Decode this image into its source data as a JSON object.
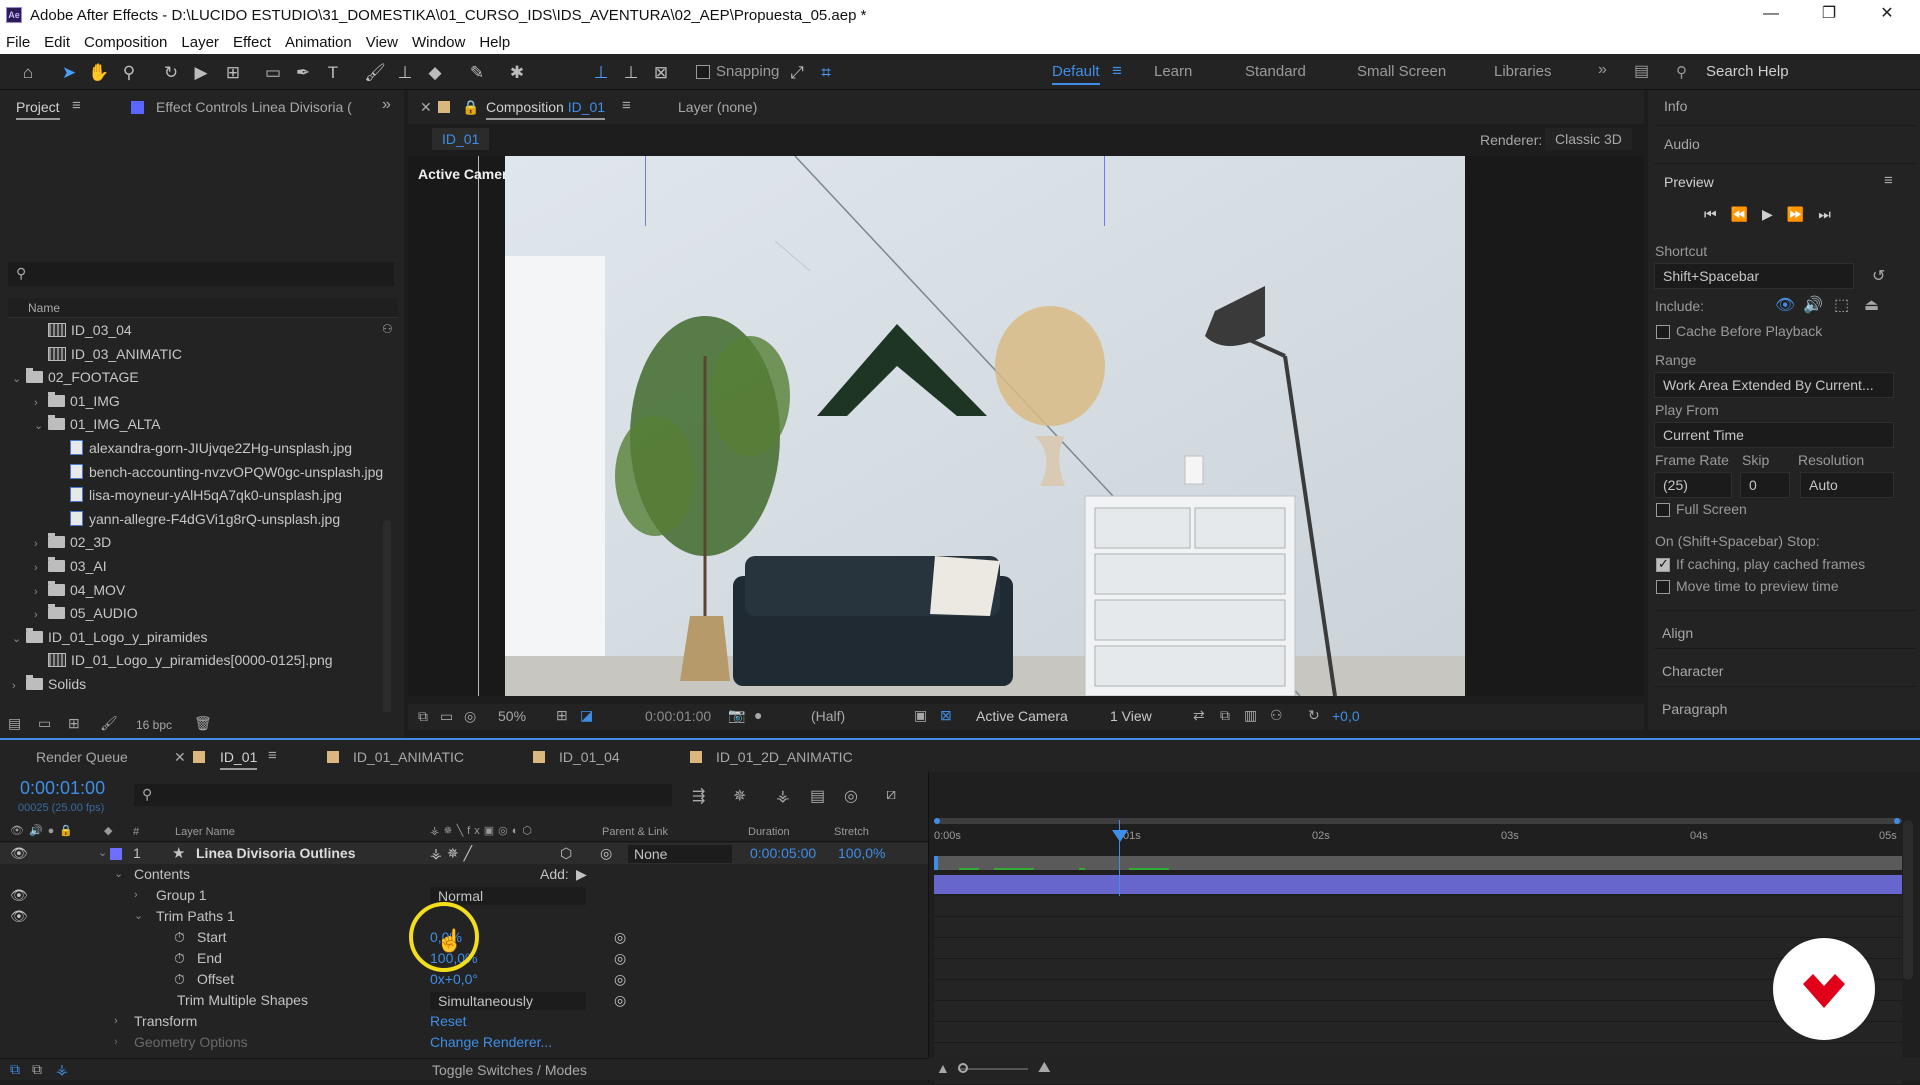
{
  "window": {
    "title": "Adobe After Effects - D:\\LUCIDO ESTUDIO\\31_DOMESTIKA\\01_CURSO_IDS\\IDS_AVENTURA\\02_AEP\\Propuesta_05.aep *",
    "app_icon": "Ae"
  },
  "menu": [
    "File",
    "Edit",
    "Composition",
    "Layer",
    "Effect",
    "Animation",
    "View",
    "Window",
    "Help"
  ],
  "toolbar": {
    "snapping": "Snapping",
    "workspaces": [
      "Default",
      "Learn",
      "Standard",
      "Small Screen",
      "Libraries"
    ],
    "search_placeholder": "Search Help"
  },
  "project_panel": {
    "tab": "Project",
    "effect_tab": "Effect Controls Linea Divisoria (",
    "col_name": "Name",
    "bpc": "16 bpc",
    "items": [
      {
        "label": "ID_03_04",
        "type": "comp",
        "indent": 1
      },
      {
        "label": "ID_03_ANIMATIC",
        "type": "comp",
        "indent": 1
      },
      {
        "label": "02_FOOTAGE",
        "type": "folder",
        "indent": 0,
        "open": true
      },
      {
        "label": "01_IMG",
        "type": "folder",
        "indent": 1,
        "open": false
      },
      {
        "label": "01_IMG_ALTA",
        "type": "folder",
        "indent": 1,
        "open": true
      },
      {
        "label": "alexandra-gorn-JIUjvqe2ZHg-unsplash.jpg",
        "type": "file",
        "indent": 2
      },
      {
        "label": "bench-accounting-nvzvOPQW0gc-unsplash.jpg",
        "type": "file",
        "indent": 2
      },
      {
        "label": "lisa-moyneur-yAlH5qA7qk0-unsplash.jpg",
        "type": "file",
        "indent": 2
      },
      {
        "label": "yann-allegre-F4dGVi1g8rQ-unsplash.jpg",
        "type": "file",
        "indent": 2
      },
      {
        "label": "02_3D",
        "type": "folder",
        "indent": 1,
        "open": false
      },
      {
        "label": "03_AI",
        "type": "folder",
        "indent": 1,
        "open": false
      },
      {
        "label": "04_MOV",
        "type": "folder",
        "indent": 1,
        "open": false
      },
      {
        "label": "05_AUDIO",
        "type": "folder",
        "indent": 1,
        "open": false
      },
      {
        "label": "ID_01_Logo_y_piramides",
        "type": "folder",
        "indent": 0,
        "open": true
      },
      {
        "label": "ID_01_Logo_y_piramides[0000-0125].png",
        "type": "comp",
        "indent": 1
      },
      {
        "label": "Solids",
        "type": "folder",
        "indent": 0,
        "open": false
      }
    ]
  },
  "comp_panel": {
    "tab_prefix": "Composition ",
    "tab_comp": "ID_01",
    "layer_tab": "Layer  (none)",
    "breadcrumb": "ID_01",
    "renderer_label": "Renderer:",
    "renderer": "Classic 3D",
    "active_camera": "Active Camera",
    "footer": {
      "zoom": "50%",
      "time": "0:00:01:00",
      "resolution": "(Half)",
      "view": "Active Camera",
      "views": "1 View",
      "exposure": "+0,0"
    }
  },
  "right_panel": {
    "info": "Info",
    "audio": "Audio",
    "preview": "Preview",
    "shortcut_label": "Shortcut",
    "shortcut": "Shift+Spacebar",
    "include_label": "Include:",
    "cache_before": "Cache Before Playback",
    "range_label": "Range",
    "range": "Work Area Extended By Current...",
    "play_from_label": "Play From",
    "play_from": "Current Time",
    "frame_rate_label": "Frame Rate",
    "skip_label": "Skip",
    "resolution_label": "Resolution",
    "frame_rate": "(25)",
    "skip": "0",
    "resolution": "Auto",
    "full_screen": "Full Screen",
    "stop_label": "On (Shift+Spacebar) Stop:",
    "if_caching": "If caching, play cached frames",
    "move_time": "Move time to preview time",
    "align": "Align",
    "character": "Character",
    "paragraph": "Paragraph"
  },
  "timeline": {
    "tabs": [
      "Render Queue",
      "ID_01",
      "ID_01_ANIMATIC",
      "ID_01_04",
      "ID_01_2D_ANIMATIC"
    ],
    "timecode": "0:00:01:00",
    "frames": "00025 (25.00 fps)",
    "cols": {
      "num": "#",
      "layer_name": "Layer Name",
      "parent": "Parent & Link",
      "duration": "Duration",
      "stretch": "Stretch"
    },
    "ruler": [
      "0:00s",
      "01s",
      "02s",
      "03s",
      "04s",
      "05s"
    ],
    "layer": {
      "num": "1",
      "name": "Linea Divisoria Outlines",
      "parent": "None",
      "duration": "0:00:05:00",
      "stretch": "100,0%"
    },
    "props": {
      "contents": "Contents",
      "add": "Add:",
      "group1": "Group 1",
      "blend": "Normal",
      "trim": "Trim Paths 1",
      "start": "Start",
      "start_val": "0,0%",
      "end": "End",
      "end_val": "100,0%",
      "offset": "Offset",
      "offset_val": "0x+0,0°",
      "trim_multi": "Trim Multiple Shapes",
      "trim_multi_val": "Simultaneously",
      "transform": "Transform",
      "reset": "Reset",
      "geometry": "Geometry Options",
      "change_renderer": "Change Renderer..."
    },
    "footer": "Toggle Switches / Modes"
  }
}
